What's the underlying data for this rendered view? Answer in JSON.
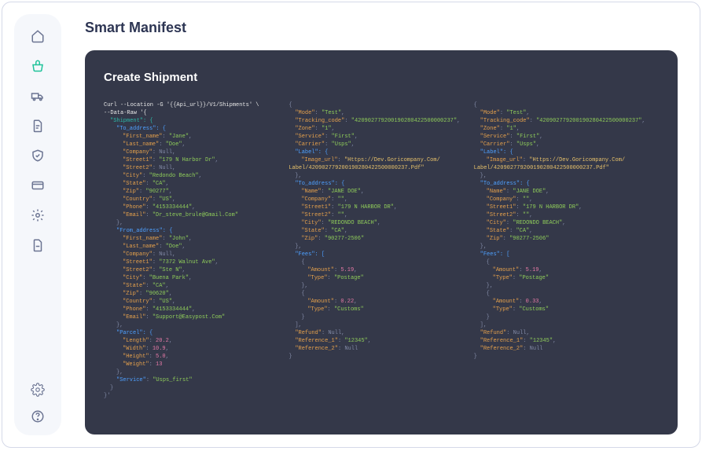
{
  "page": {
    "title": "Smart Manifest",
    "panel_title": "Create Shipment"
  },
  "sidebar": {
    "items": [
      {
        "name": "home"
      },
      {
        "name": "basket",
        "active": true
      },
      {
        "name": "truck"
      },
      {
        "name": "document"
      },
      {
        "name": "shield"
      },
      {
        "name": "card"
      },
      {
        "name": "gear"
      },
      {
        "name": "file"
      }
    ],
    "bottom": [
      {
        "name": "settings"
      },
      {
        "name": "help"
      }
    ]
  },
  "col1": {
    "cmd": "Curl --Location -G '{{Api_url}}/V1/Shipments' \\",
    "data_raw": "--Data-Raw '{",
    "shipment": "\"Shipment\": {",
    "to_address": "\"To_address\": {",
    "to_first_name_k": "\"First_name\"",
    "to_first_name_v": "\"Jane\"",
    "to_last_name_k": "\"Last_name\"",
    "to_last_name_v": "\"Doe\"",
    "to_company_k": "\"Company\"",
    "to_company_v": "Null",
    "to_street1_k": "\"Street1\"",
    "to_street1_v": "\"179 N Harbor Dr\"",
    "to_street2_k": "\"Street2\"",
    "to_street2_v": "Null",
    "to_city_k": "\"City\"",
    "to_city_v": "\"Redondo Beach\"",
    "to_state_k": "\"State\"",
    "to_state_v": "\"CA\"",
    "to_zip_k": "\"Zip\"",
    "to_zip_v": "\"90277\"",
    "to_country_k": "\"Country\"",
    "to_country_v": "\"US\"",
    "to_phone_k": "\"Phone\"",
    "to_phone_v": "\"4153334444\"",
    "to_email_k": "\"Email\"",
    "to_email_v": "\"Dr_steve_brule@Gmail.Com\"",
    "close_to": "},",
    "from_address": "\"From_address\": {",
    "fr_first_name_k": "\"First_name\"",
    "fr_first_name_v": "\"John\"",
    "fr_last_name_k": "\"Last_name\"",
    "fr_last_name_v": "\"Doe\"",
    "fr_company_k": "\"Company\"",
    "fr_company_v": "Null",
    "fr_street1_k": "\"Street1\"",
    "fr_street1_v": "\"7372 Walnut Ave\"",
    "fr_street2_k": "\"Street2\"",
    "fr_street2_v": "\"Ste N\"",
    "fr_city_k": "\"City\"",
    "fr_city_v": "\"Buena Park\"",
    "fr_state_k": "\"State\"",
    "fr_state_v": "\"CA\"",
    "fr_zip_k": "\"Zip\"",
    "fr_zip_v": "\"90620\"",
    "fr_country_k": "\"Country\"",
    "fr_country_v": "\"US\"",
    "fr_phone_k": "\"Phone\"",
    "fr_phone_v": "\"4153334444\"",
    "fr_email_k": "\"Email\"",
    "fr_email_v": "\"Support@Easypost.Com\"",
    "close_from": "},",
    "parcel": "\"Parcel\": {",
    "p_length_k": "\"Length\"",
    "p_length_v": "20.2",
    "p_width_k": "\"Width\"",
    "p_width_v": "10.9",
    "p_height_k": "\"Height\"",
    "p_height_v": "5.0",
    "p_weight_k": "\"Weight\"",
    "p_weight_v": "13",
    "close_parcel": "},",
    "service_k": "\"Service\"",
    "service_v": "\"Usps_first\"",
    "close_ship": "}",
    "close_all": "}'"
  },
  "col2": {
    "open": "{",
    "mode_k": "\"Mode\"",
    "mode_v": "\"Test\"",
    "track_k": "\"Tracking_code\"",
    "track_v": "\"420902779200190280422500000237\"",
    "zone_k": "\"Zone\"",
    "zone_v": "\"1\"",
    "service_k": "\"Service\"",
    "service_v": "\"First\"",
    "carrier_k": "\"Carrier\"",
    "carrier_v": "\"Usps\"",
    "label_k": "\"Label\": {",
    "img_k": "\"Image_url\"",
    "img_v1": "\"Https://Dev.Goricompany.Com/",
    "img_v2": "Label/420902779200190280422500000237.Pdf\"",
    "close_label": "},",
    "to_addr_k": "\"To_address\": {",
    "name_k": "\"Name\"",
    "name_v": "\"JANE DOE\"",
    "company_k": "\"Company\"",
    "company_v": "\"\"",
    "street1_k": "\"Street1\"",
    "street1_v": "\"179 N HARBOR DR\"",
    "street2_k": "\"Street2\"",
    "street2_v": "\"\"",
    "city_k": "\"City\"",
    "city_v": "\"REDONDO BEACH\"",
    "state_k": "\"State\"",
    "state_v": "\"CA\"",
    "zip_k": "\"Zip\"",
    "zip_v": "\"90277-2506\"",
    "close_to": "},",
    "fees_k": "\"Fees\": [",
    "obr": "{",
    "f1_amt_k": "\"Amount\"",
    "f1_amt_v": "5.19",
    "f1_type_k": "\"Type\"",
    "f1_type_v": "\"Postage\"",
    "cbr": "},",
    "f2_amt_k": "\"Amount\"",
    "f2_amt_v": "0.22",
    "f2_type_k": "\"Type\"",
    "f2_type_v": "\"Customs\"",
    "cbr2": "}",
    "close_fees": "],",
    "refund_k": "\"Refund\"",
    "refund_v": "Null",
    "ref1_k": "\"Reference_1\"",
    "ref1_v": "\"12345\"",
    "ref2_k": "\"Reference_2\"",
    "ref2_v": "Null",
    "close": "}"
  },
  "col3": {
    "open": "{",
    "mode_k": "\"Mode\"",
    "mode_v": "\"Test\"",
    "track_k": "\"Tracking_code\"",
    "track_v": "\"420902779200190280422500000237\"",
    "zone_k": "\"Zone\"",
    "zone_v": "\"1\"",
    "service_k": "\"Service\"",
    "service_v": "\"First\"",
    "carrier_k": "\"Carrier\"",
    "carrier_v": "\"Usps\"",
    "label_k": "\"Label\": {",
    "img_k": "\"Image_url\"",
    "img_v1": "\"Https://Dev.Goricompany.Com/",
    "img_v2": "Label/420902779200190280422500000237.Pdf\"",
    "close_label": "},",
    "to_addr_k": "\"To_address\": {",
    "name_k": "\"Name\"",
    "name_v": "\"JANE DOE\"",
    "company_k": "\"Company\"",
    "company_v": "\"\"",
    "street1_k": "\"Street1\"",
    "street1_v": "\"179 N HARBOR DR\"",
    "street2_k": "\"Street2\"",
    "street2_v": "\"\"",
    "city_k": "\"City\"",
    "city_v": "\"REDONDO BEACH\"",
    "state_k": "\"State\"",
    "state_v": "\"CA\"",
    "zip_k": "\"Zip\"",
    "zip_v": "\"90277-2506\"",
    "close_to": "},",
    "fees_k": "\"Fees\": [",
    "obr": "{",
    "f1_amt_k": "\"Amount\"",
    "f1_amt_v": "5.19",
    "f1_type_k": "\"Type\"",
    "f1_type_v": "\"Postage\"",
    "cbr": "},",
    "f2_amt_k": "\"Amount\"",
    "f2_amt_v": "0.33",
    "f2_type_k": "\"Type\"",
    "f2_type_v": "\"Customs\"",
    "cbr2": "}",
    "close_fees": "],",
    "refund_k": "\"Refund\"",
    "refund_v": "Null",
    "ref1_k": "\"Reference_1\"",
    "ref1_v": "\"12345\"",
    "ref2_k": "\"Reference_2\"",
    "ref2_v": "Null",
    "close": "}"
  }
}
